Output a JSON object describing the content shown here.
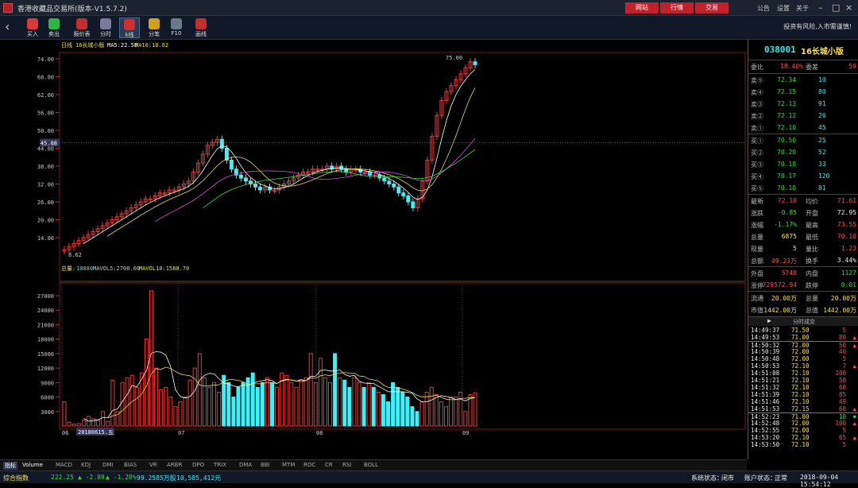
{
  "window": {
    "title": "香港收藏品交易所(版本-V1.5.7.2)",
    "buttons": [
      "网站",
      "行情",
      "交易"
    ],
    "links": [
      "公告",
      "设置",
      "关于"
    ]
  },
  "toolbar": {
    "items": [
      {
        "label": "买入",
        "icon": "buy-icon",
        "color": "#d83a3a"
      },
      {
        "label": "卖出",
        "icon": "sell-icon",
        "color": "#2fb44a"
      },
      {
        "label": "报价表",
        "icon": "quote-table-icon",
        "color": "#c03030"
      },
      {
        "label": "分时",
        "icon": "timeshare-icon",
        "color": "#7a7a9a"
      },
      {
        "label": "k线",
        "icon": "kline-icon",
        "color": "#d03030"
      },
      {
        "label": "分笔",
        "icon": "tick-icon",
        "color": "#d0a020"
      },
      {
        "label": "F10",
        "icon": "f10-icon",
        "color": "#6a7a8a"
      },
      {
        "label": "画线",
        "icon": "draw-line-icon",
        "color": "#c03030"
      }
    ],
    "risk_notice": "投资有风险,入市需谨慎!"
  },
  "chart": {
    "header_label": "日线",
    "name": "16长城小版",
    "ma5": "MA5:22.58",
    "ma10": "MA10:18.62",
    "price_ticks": [
      "74.00",
      "68.00",
      "62.00",
      "56.00",
      "50.00",
      "44.00",
      "38.00",
      "32.00",
      "26.00",
      "20.00",
      "14.00"
    ],
    "crosshair_price": "45.88",
    "high_mark": "75.00",
    "low_mark": "8.62",
    "vol_label": "总量:",
    "vol_value": "10880",
    "mavol5": "MAVOL5:2708.60",
    "mavol10": "MAVOL10:1588.70",
    "vol_ticks": [
      "27000",
      "24000",
      "21000",
      "18000",
      "15000",
      "12000",
      "9000",
      "6000",
      "3000"
    ],
    "months": [
      "06",
      "07",
      "08",
      "09"
    ],
    "date_cursor": "20180615.五",
    "colors": {
      "up": "#ff3030",
      "down": "#40f0f8",
      "ma5": "#ffffff",
      "ma10": "#e8e050",
      "ma20": "#e050e0",
      "ma30": "#40e040"
    }
  },
  "quote": {
    "code": "038001",
    "name": "16长城小版",
    "weibi_label": "委比",
    "weibi_value": "18.40%",
    "weicha_label": "委差",
    "weicha_value": "59",
    "sells": [
      {
        "label": "卖⑤",
        "price": "72.34",
        "vol": "10"
      },
      {
        "label": "卖④",
        "price": "72.15",
        "vol": "80"
      },
      {
        "label": "卖③",
        "price": "72.13",
        "vol": "91"
      },
      {
        "label": "卖②",
        "price": "72.12",
        "vol": "26"
      },
      {
        "label": "卖①",
        "price": "72.10",
        "vol": "45"
      }
    ],
    "buys": [
      {
        "label": "买①",
        "price": "70.50",
        "vol": "25"
      },
      {
        "label": "买②",
        "price": "70.20",
        "vol": "52"
      },
      {
        "label": "买③",
        "price": "70.18",
        "vol": "33"
      },
      {
        "label": "买④",
        "price": "70.17",
        "vol": "120"
      },
      {
        "label": "买⑤",
        "price": "70.10",
        "vol": "81"
      }
    ],
    "stats": [
      {
        "l1": "最新",
        "v1": "72.10",
        "c1": "red",
        "l2": "均价",
        "v2": "71.61",
        "c2": "red"
      },
      {
        "l1": "涨跌",
        "v1": "-0.85",
        "c1": "green",
        "l2": "开盘",
        "v2": "72.95",
        "c2": "white"
      },
      {
        "l1": "涨幅",
        "v1": "-1.17%",
        "c1": "green",
        "l2": "最高",
        "v2": "73.55",
        "c2": "red"
      },
      {
        "l1": "总量",
        "v1": "6875",
        "c1": "yellow",
        "l2": "最低",
        "v2": "70.10",
        "c2": "red"
      },
      {
        "l1": "现量",
        "v1": "5",
        "c1": "yellow",
        "l2": "量比",
        "v2": "1.23",
        "c2": "red"
      },
      {
        "l1": "总额",
        "v1": "49.23万",
        "c1": "red",
        "l2": "换手",
        "v2": "3.44%",
        "c2": "white"
      }
    ],
    "stats2": [
      {
        "l1": "外盘",
        "v1": "5748",
        "c1": "red",
        "l2": "内盘",
        "v2": "1127",
        "c2": "green"
      },
      {
        "l1": "涨停",
        "v1": "729572.94",
        "c1": "red",
        "l2": "跌停",
        "v2": "0.01",
        "c2": "green"
      }
    ],
    "stats3": [
      {
        "l1": "流通",
        "v1": "20.00万",
        "c1": "yellow",
        "l2": "总量",
        "v2": "20.00万",
        "c2": "yellow"
      },
      {
        "l1": "市值",
        "v1": "1442.00万",
        "c1": "yellow",
        "l2": "总值",
        "v2": "1442.00万",
        "c2": "yellow"
      }
    ],
    "tick_header": "分时成交",
    "ticks": [
      {
        "t": "14:49:37",
        "p": "71.50",
        "v": "5",
        "m": ""
      },
      {
        "t": "14:49:53",
        "p": "71.00",
        "v": "80",
        "m": "up"
      },
      {
        "t": "14:50:32",
        "p": "72.00",
        "v": "50",
        "m": "up"
      },
      {
        "t": "14:50:39",
        "p": "72.00",
        "v": "40",
        "m": ""
      },
      {
        "t": "14:50:48",
        "p": "72.00",
        "v": "5",
        "m": ""
      },
      {
        "t": "14:50:53",
        "p": "72.10",
        "v": "7",
        "m": "up"
      },
      {
        "t": "14:51:08",
        "p": "72.10",
        "v": "100",
        "m": ""
      },
      {
        "t": "14:51:21",
        "p": "72.10",
        "v": "50",
        "m": ""
      },
      {
        "t": "14:51:32",
        "p": "72.10",
        "v": "60",
        "m": ""
      },
      {
        "t": "14:51:39",
        "p": "72.10",
        "v": "85",
        "m": ""
      },
      {
        "t": "14:51:46",
        "p": "72.10",
        "v": "49",
        "m": ""
      },
      {
        "t": "14:51:53",
        "p": "72.15",
        "v": "60",
        "m": "up"
      },
      {
        "t": "14:52:23",
        "p": "71.00",
        "v": "10",
        "m": "down"
      },
      {
        "t": "14:52:48",
        "p": "72.00",
        "v": "100",
        "m": "up"
      },
      {
        "t": "14:52:55",
        "p": "72.00",
        "v": "5",
        "m": ""
      },
      {
        "t": "14:53:20",
        "p": "72.10",
        "v": "65",
        "m": "up"
      },
      {
        "t": "14:53:50",
        "p": "72.10",
        "v": "5",
        "m": ""
      }
    ]
  },
  "bottom_tabs": [
    "指标",
    "Volume",
    "MACD",
    "KDJ",
    "DMI",
    "BIAS",
    "VR",
    "ARBR",
    "DPO",
    "TRIX",
    "DMA",
    "BBI",
    "MTM",
    "ROC",
    "CR",
    "RSI",
    "BOLL"
  ],
  "status": {
    "index_label": "综合指数",
    "index_value": "222.25",
    "change": "▲ -2.89",
    "pct": "▲ -1.28%",
    "volume": "99.2585万股",
    "amount": "10,585,412元",
    "sys_label": "系统状态：",
    "sys_value": "闭市",
    "acct_label": "账户状态：",
    "acct_value": "正常",
    "datetime": "2018-09-04 15:54:12"
  }
}
